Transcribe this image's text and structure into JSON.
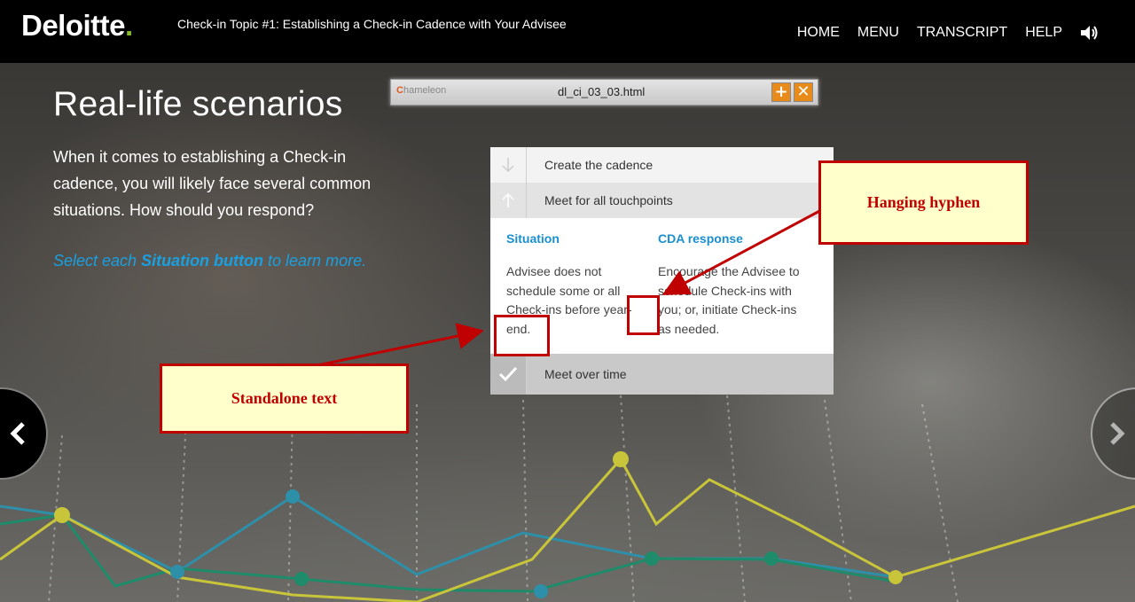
{
  "header": {
    "logo_text": "Deloitte",
    "logo_dot": ".",
    "course_title": "Check-in Topic #1: Establishing a Check-in Cadence with Your Advisee",
    "nav": [
      "HOME",
      "MENU",
      "TRANSCRIPT",
      "HELP"
    ],
    "audio_icon": "speaker-icon"
  },
  "main": {
    "heading": "Real-life scenarios",
    "intro": "When it comes to establishing a Check-in cadence, you will likely face several common situations. How should you respond?",
    "instruction_prefix": "Select each ",
    "instruction_bold": "Situation button",
    "instruction_suffix": " to learn more."
  },
  "chameleon": {
    "logo": "hameleon",
    "logo_c": "C",
    "filename": "dl_ci_03_03.html",
    "add_label": "+",
    "close_label": "✕"
  },
  "panel": {
    "rows": [
      {
        "label": "Create the cadence",
        "icon": "arrow-down-icon"
      },
      {
        "label": "Meet for all touchpoints",
        "icon": "arrow-up-icon"
      },
      {
        "label": "Meet over time",
        "icon": "checkmark-icon"
      }
    ],
    "situation_header": "Situation",
    "response_header": "CDA response",
    "situation_text": "Advisee does not schedule some or all Check-ins before year-end.",
    "response_text": "Encourage the Advisee to schedule Check-ins with you; or, initiate Check-ins as needed."
  },
  "annotations": {
    "hanging_hyphen": "Hanging hyphen",
    "standalone_text": "Standalone text",
    "color": "#c00000"
  },
  "colors": {
    "accent_green": "#86bc25",
    "link_blue": "#1aa0e0"
  }
}
